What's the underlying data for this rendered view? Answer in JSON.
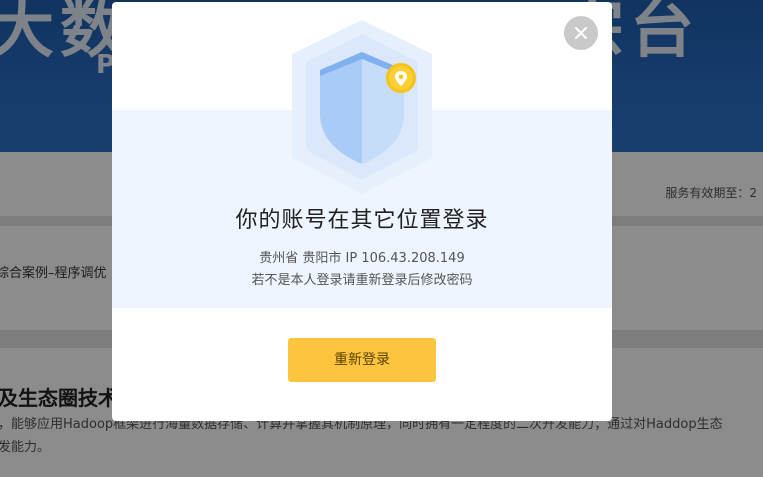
{
  "background": {
    "banner_left": "大数",
    "banner_right": "宗台",
    "banner_sub": "P",
    "service_text": "服务有效期至：2",
    "tab_text": "综合案例–程序调优",
    "section_heading": "及生态圈技术",
    "desc_line1": "，能够应用Hadoop框架进行海量数据存储、计算并掌握其机制原理，同时拥有一定程度的二次开发能力；通过对Haddop生态",
    "desc_line2": "发能力。"
  },
  "modal": {
    "title": "你的账号在其它位置登录",
    "location": "贵州省 贵阳市 IP 106.43.208.149",
    "tip": "若不是本人登录请重新登录后修改密码",
    "button_label": "重新登录",
    "icons": {
      "close": "close-icon",
      "shield": "shield-icon",
      "location": "location-pin-icon"
    },
    "colors": {
      "button": "#fcc43f",
      "shield": "#9cc3f5",
      "pin": "#f7c21c"
    }
  }
}
